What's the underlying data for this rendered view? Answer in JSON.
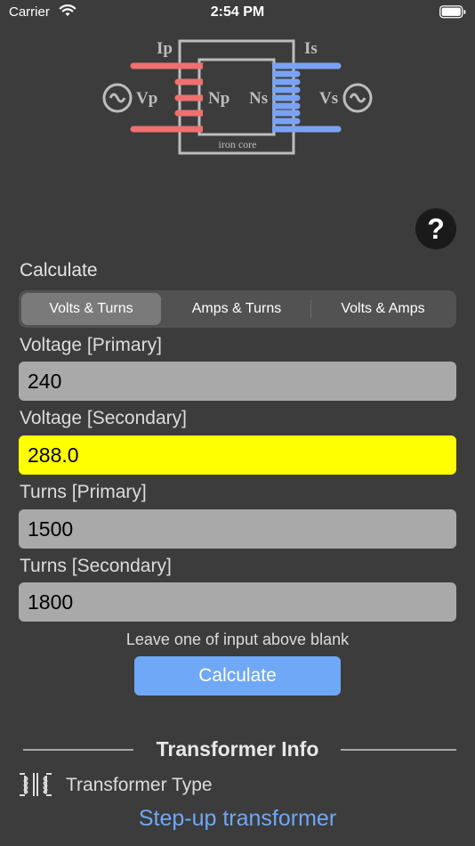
{
  "status_bar": {
    "carrier": "Carrier",
    "time": "2:54 PM"
  },
  "diagram": {
    "ip": "Ip",
    "is": "Is",
    "vp": "Vp",
    "vs": "Vs",
    "np": "Np",
    "ns": "Ns",
    "core": "iron core",
    "colors": {
      "primary": "#f07070",
      "secondary": "#7aa2f4",
      "core": "#bdbdbd"
    }
  },
  "help": {
    "label": "?"
  },
  "calculate": {
    "title": "Calculate",
    "tabs": [
      "Volts & Turns",
      "Amps & Turns",
      "Volts & Amps"
    ],
    "selected_tab": "Volts & Turns"
  },
  "fields": {
    "voltage_primary": {
      "label": "Voltage [Primary]",
      "value": "240"
    },
    "voltage_secondary": {
      "label": "Voltage [Secondary]",
      "value": "288.0"
    },
    "turns_primary": {
      "label": "Turns [Primary]",
      "value": "1500"
    },
    "turns_secondary": {
      "label": "Turns [Secondary]",
      "value": "1800"
    }
  },
  "hint": "Leave one of input above blank",
  "calculate_button": "Calculate",
  "info": {
    "title": "Transformer Info",
    "type_label": "Transformer Type",
    "type_value": "Step-up transformer"
  },
  "colors": {
    "background": "#3c3c3c",
    "accent": "#6ea8f7",
    "result_highlight": "#ffff00"
  }
}
